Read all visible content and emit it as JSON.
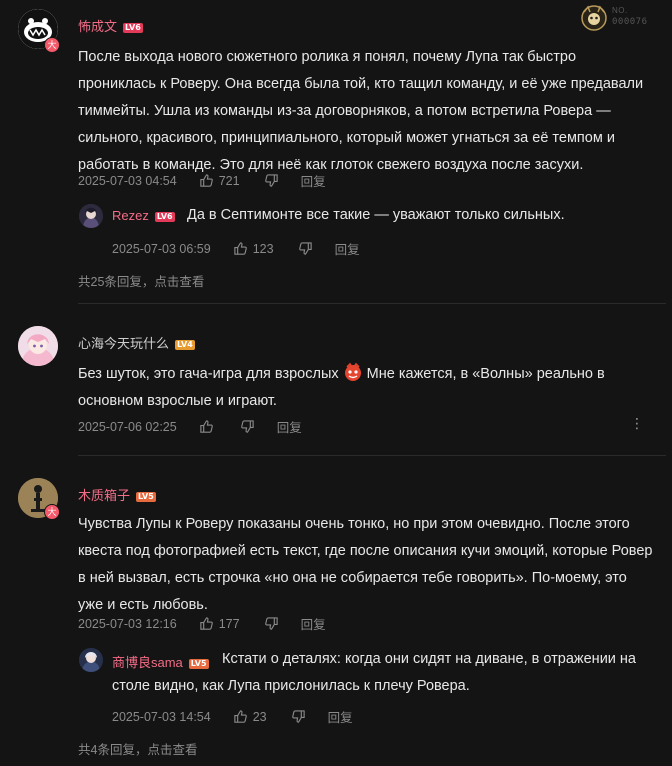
{
  "fan_badge": {
    "label": "NO.",
    "number": "000076"
  },
  "comments": [
    {
      "username": "怖成文",
      "level": "LV6",
      "text": "После выхода нового сюжетного ролика я понял, почему Лупа так быстро прониклась к Роверу. Она всегда была той, кто тащил команду, и её уже предавали тиммейты. Ушла из команды из-за договорняков, а потом встретила Ровера — сильного, красивого, принципиального, который может угнаться за её темпом и работать в команде. Это для неё как глоток свежего воздуха после засухи.",
      "time": "2025-07-03 04:54",
      "likes": "721",
      "reply_label": "回复",
      "reply": {
        "username": "Rezez",
        "level": "LV6",
        "text": "Да в Септимонте все такие — уважают только сильных.",
        "time": "2025-07-03 06:59",
        "likes": "123",
        "reply_label": "回复"
      },
      "more_replies": "共25条回复，点击查看"
    },
    {
      "username": "心海今天玩什么",
      "level": "LV4",
      "text_before": "Без шуток, это гача-игра для взрослых",
      "text_after": " Мне кажется, в «Волны» реально в основном взрослые и играют.",
      "time": "2025-07-06 02:25",
      "reply_label": "回复"
    },
    {
      "username": "木质箱子",
      "level": "LV5",
      "text": "Чувства Лупы к Роверу показаны очень тонко, но при этом очевидно. После этого квеста под фотографией есть текст, где после описания кучи эмоций, которые Ровер в ней вызвал, есть строчка «но она не собирается тебе говорить». По-моему, это уже и есть любовь.",
      "time": "2025-07-03 12:16",
      "likes": "177",
      "reply_label": "回复",
      "reply": {
        "username": "商博良sama",
        "level": "LV5",
        "text": "Кстати о деталях: когда они сидят на диване, в отражении на столе видно, как Лупа прислонилась к плечу Ровера.",
        "time": "2025-07-03 14:54",
        "likes": "23",
        "reply_label": "回复"
      },
      "more_replies": "共4条回复，点击查看"
    }
  ],
  "badge_char": "大"
}
